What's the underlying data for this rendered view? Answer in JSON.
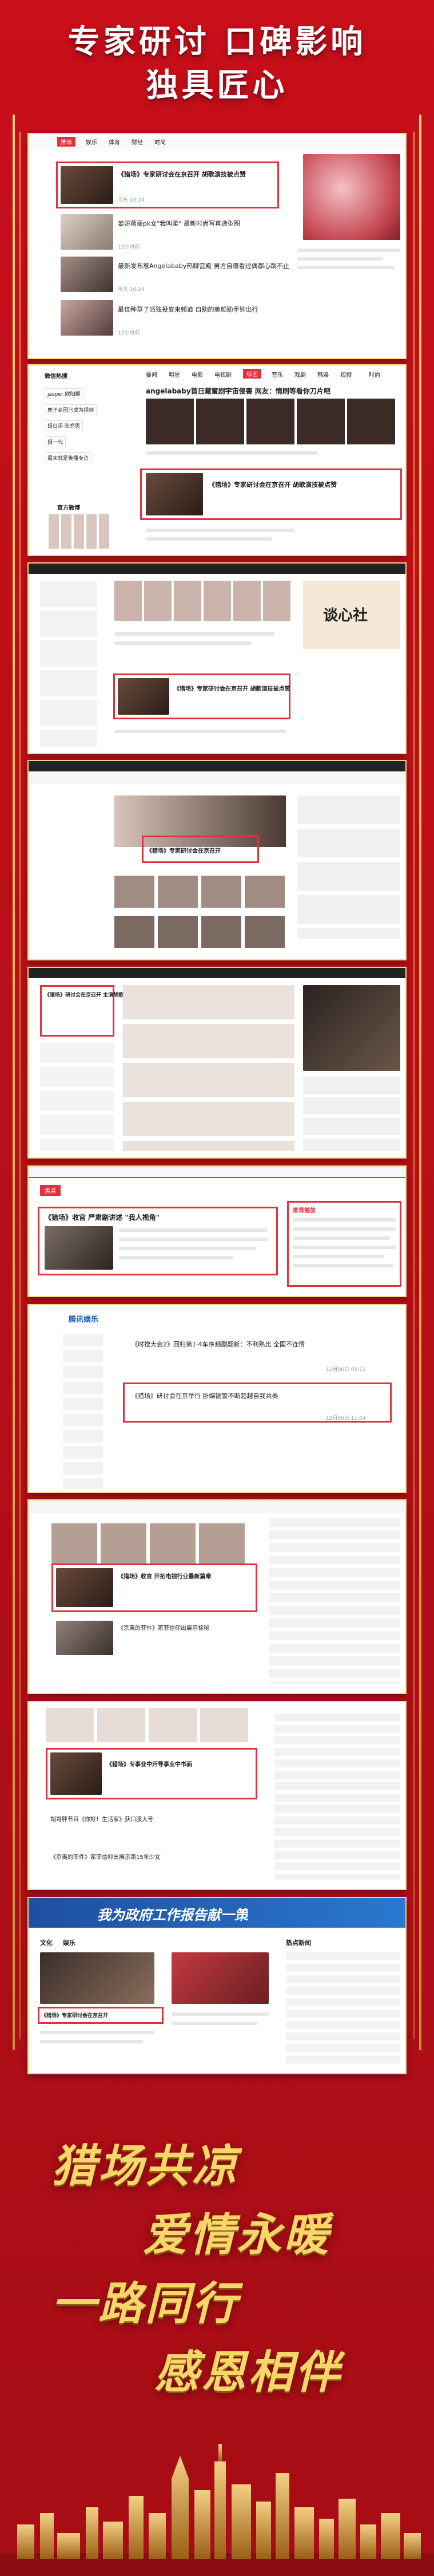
{
  "header": {
    "line1": "专家研讨 口碑影响",
    "line2": "独具匠心"
  },
  "panel1": {
    "tabs": [
      "推荐",
      "娱乐",
      "体育",
      "财经",
      "时尚"
    ],
    "items": [
      {
        "title": "《猎场》专家研讨会在京召开 胡歌演技被点赞",
        "meta": "今天 10:24"
      },
      {
        "title": "姜妍蒋豪pk女\"我叫柔\" 最新时尚写真造型图",
        "meta": "12小时前"
      },
      {
        "title": "最新发布惹Angelababy热聊宫殿 男方自曝看过偶都心跳不止",
        "meta": "12小时前"
      },
      {
        "title": "最佳种草了派独投变来频道 自助的美颜助手钟出行",
        "meta": "12小时前"
      }
    ]
  },
  "panel2": {
    "sidebar": [
      "微信热搜",
      "jasper 欧阳娜",
      "鹿子乡团已成为视频",
      "姐日评 陈乔恩",
      "姐一代",
      "周末就是美播专访"
    ],
    "sidebar_title": "官方微博",
    "tabs": [
      "要闻",
      "明星",
      "电影",
      "电视剧",
      "综艺",
      "音乐",
      "戏剧",
      "韩娱",
      "视频",
      "时尚"
    ],
    "headline": "angelababy首日藏蜜剧宇宙侵害 网友：情刷等看你刀片吧",
    "item": "《猎场》专家研讨会在京召开 胡歌演技被点赞"
  },
  "panel3": {
    "title": "谈心社",
    "item": "《猎场》专家研讨会在京召开 胡歌演技被点赞"
  },
  "panel4": {
    "item": "《猎场》专家研讨会在京召开"
  },
  "panel5": {
    "item": "《猎场》研讨会在京召开 主演胡歌被赞"
  },
  "panel6": {
    "tag": "焦点",
    "headline": "《猎场》收官 严肃剧讲述 \"我人视角\"",
    "side_title": "推荐播放"
  },
  "panel7": {
    "brand": "腾讯娱乐",
    "items": [
      {
        "title": "《时搜大会2》回归第1·4车序频剧翻新：不利熟比 全国不连情",
        "meta": "12月06日 09:11"
      },
      {
        "title": "《猎场》研讨会在京举行 卧蝶键警不断超越自我共奏",
        "meta": "12月06日 11:04"
      }
    ]
  },
  "panel8": {
    "item": "《猎场》收官 开拓电视行业最新篇章",
    "item2": "《京夷的菲件》家菲信仰出展示标秘"
  },
  "panel9": {
    "item": "《猎场》专事业中开导事业中书面",
    "item2": "胡哥胖节目《你好！生活家》获口服大号",
    "item3": "《京夷的菲件》家菲信仰出展示第15年少女"
  },
  "panel10": {
    "banner": "我为政府工作报告献一策",
    "tabs": [
      "文化",
      "娱乐"
    ],
    "side_title": "热点新闻",
    "item": "《猎场》专家研讨会在京召开"
  },
  "slogans": [
    "猎场共凉",
    "爱情永暖",
    "一路同行",
    "感恩相伴"
  ]
}
